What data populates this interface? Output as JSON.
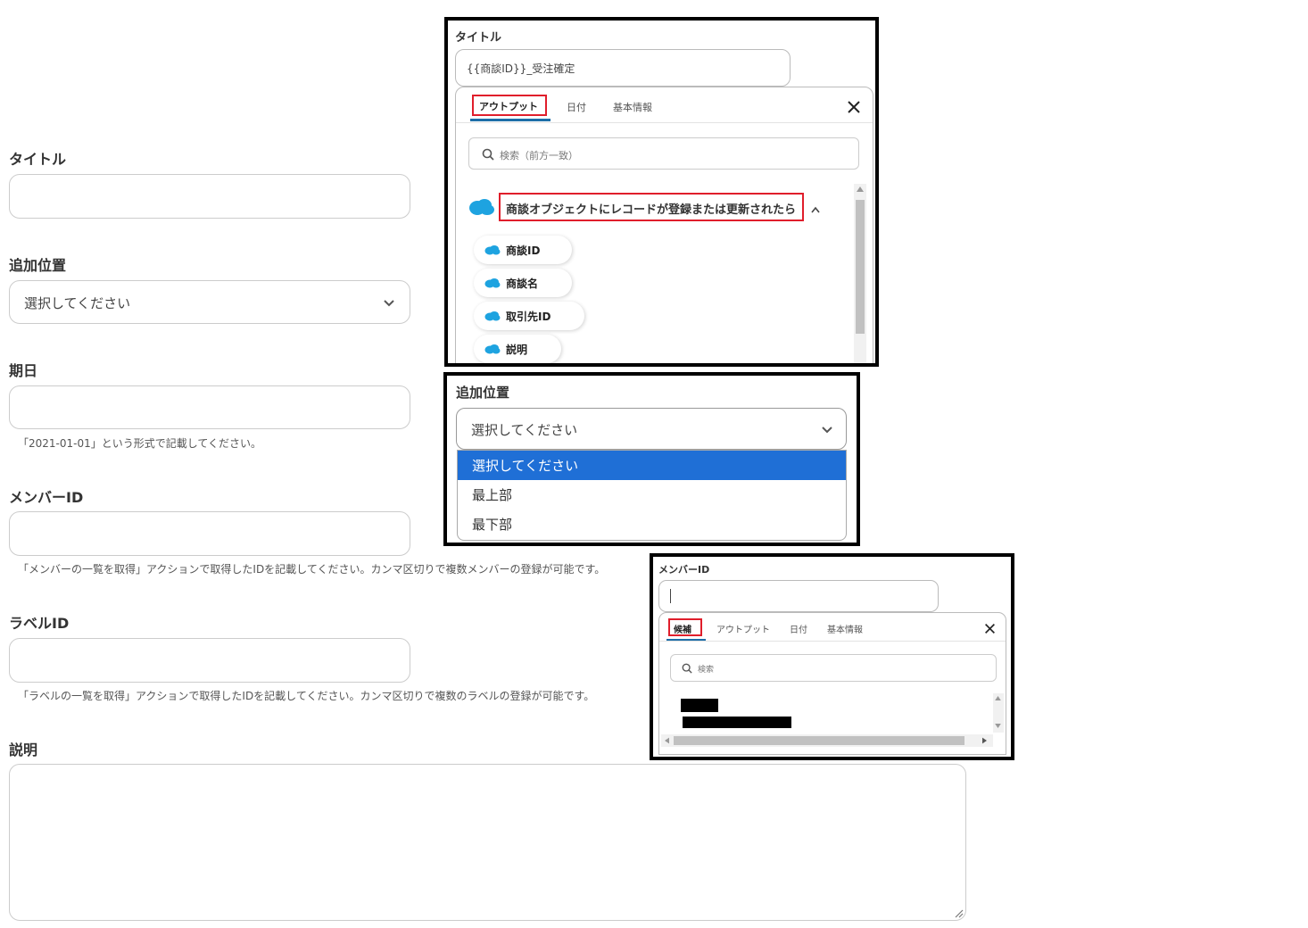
{
  "form": {
    "title_label": "タイトル",
    "position_label": "追加位置",
    "position_value": "選択してください",
    "due_label": "期日",
    "due_hint": "「2021-01-01」という形式で記載してください。",
    "member_label": "メンバーID",
    "member_hint": "「メンバーの一覧を取得」アクションで取得したIDを記載してください。カンマ区切りで複数メンバーの登録が可能です。",
    "label_label": "ラベルID",
    "label_hint": "「ラベルの一覧を取得」アクションで取得したIDを記載してください。カンマ区切りで複数のラベルの登録が可能です。",
    "desc_label": "説明"
  },
  "popup_title": {
    "label": "タイトル",
    "value": "{{商談ID}}_受注確定",
    "tabs": [
      "アウトプット",
      "日付",
      "基本情報"
    ],
    "search_placeholder": "検索（前方一致）",
    "section": "商談オブジェクトにレコードが登録または更新されたら",
    "items": [
      "商談ID",
      "商談名",
      "取引先ID",
      "説明"
    ]
  },
  "popup_position": {
    "label": "追加位置",
    "value": "選択してください",
    "options": [
      "選択してください",
      "最上部",
      "最下部"
    ]
  },
  "popup_member": {
    "label": "メンバーID",
    "tabs": [
      "候補",
      "アウトプット",
      "日付",
      "基本情報"
    ],
    "search_placeholder": "検索"
  },
  "colors": {
    "accent": "#1d6ea8",
    "highlight": "#e01e2b",
    "selected_option": "#1f6fd6",
    "salesforce": "#1ea3e0"
  },
  "icons": [
    "chevron-down-icon",
    "close-icon",
    "search-icon",
    "salesforce-cloud-icon",
    "resize-grip-icon"
  ]
}
